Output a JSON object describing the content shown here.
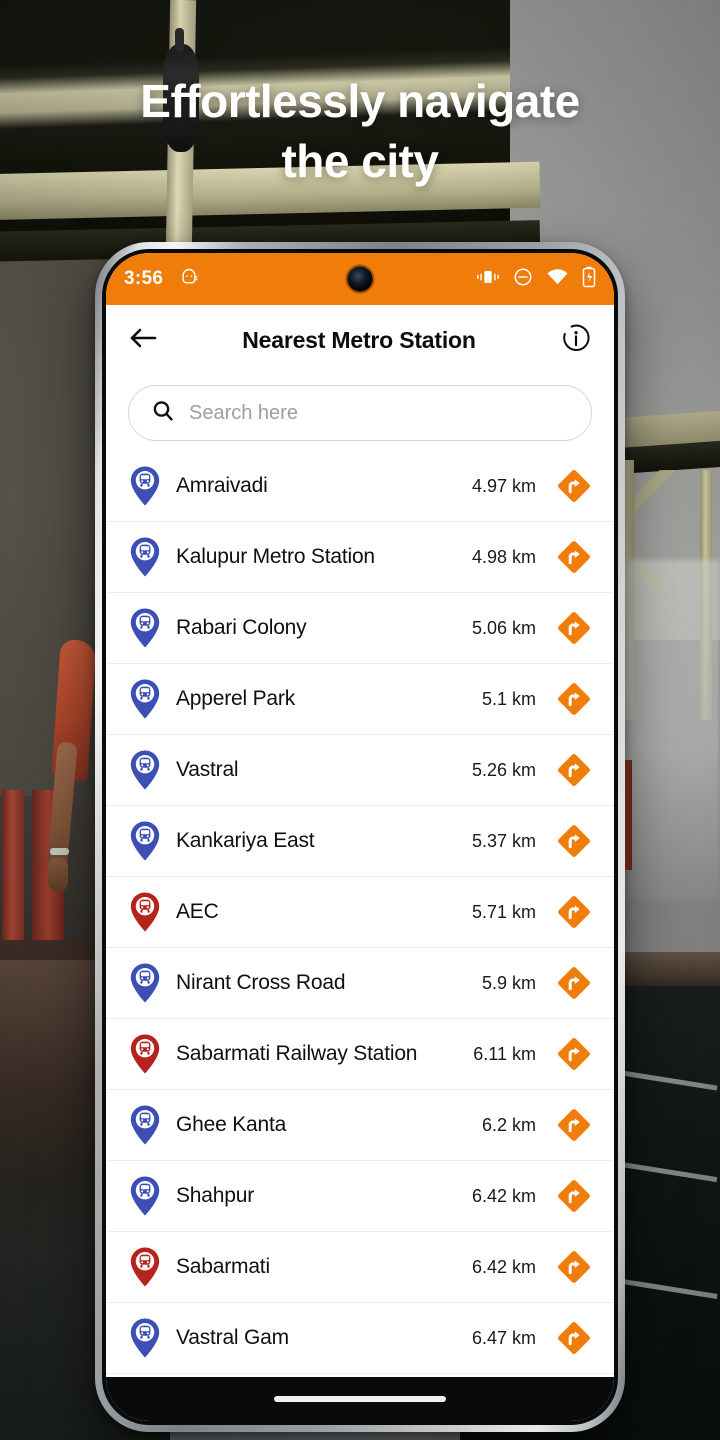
{
  "headline": "Effortlessly navigate\nthe city",
  "theme": {
    "accent_orange": "#F07C0A",
    "metro_pin_blue": "#3B4FB5",
    "railway_pin_red": "#B5241C",
    "screen_bg": "#FFFFFF"
  },
  "phone": {
    "statusbar": {
      "time": "3:56",
      "left_icons": [
        "android-debug-icon"
      ],
      "right_icons": [
        "vibrate-icon",
        "do-not-disturb-icon",
        "wifi-icon",
        "battery-charging-icon"
      ],
      "camera": "punch-hole-camera"
    },
    "appbar": {
      "back_icon": "back-arrow-icon",
      "title": "Nearest Metro Station",
      "info_icon": "info-icon"
    },
    "search": {
      "icon": "search-icon",
      "placeholder": "Search here",
      "value": ""
    },
    "list": {
      "go_icon": "directions-arrow-icon",
      "items": [
        {
          "name": "Amraivadi",
          "distance": "4.97 km",
          "pin": "metro",
          "pin_color": "#3B4FB5"
        },
        {
          "name": "Kalupur Metro Station",
          "distance": "4.98 km",
          "pin": "metro",
          "pin_color": "#3B4FB5"
        },
        {
          "name": "Rabari Colony",
          "distance": "5.06 km",
          "pin": "metro",
          "pin_color": "#3B4FB5"
        },
        {
          "name": "Apperel Park",
          "distance": "5.1 km",
          "pin": "metro",
          "pin_color": "#3B4FB5"
        },
        {
          "name": "Vastral",
          "distance": "5.26 km",
          "pin": "metro",
          "pin_color": "#3B4FB5"
        },
        {
          "name": "Kankariya East",
          "distance": "5.37 km",
          "pin": "metro",
          "pin_color": "#3B4FB5"
        },
        {
          "name": "AEC",
          "distance": "5.71 km",
          "pin": "railway",
          "pin_color": "#B5241C"
        },
        {
          "name": "Nirant Cross Road",
          "distance": "5.9 km",
          "pin": "metro",
          "pin_color": "#3B4FB5"
        },
        {
          "name": "Sabarmati Railway Station",
          "distance": "6.11 km",
          "pin": "railway",
          "pin_color": "#B5241C"
        },
        {
          "name": "Ghee Kanta",
          "distance": "6.2 km",
          "pin": "metro",
          "pin_color": "#3B4FB5"
        },
        {
          "name": "Shahpur",
          "distance": "6.42 km",
          "pin": "metro",
          "pin_color": "#3B4FB5"
        },
        {
          "name": "Sabarmati",
          "distance": "6.42 km",
          "pin": "railway",
          "pin_color": "#B5241C"
        },
        {
          "name": "Vastral Gam",
          "distance": "6.47 km",
          "pin": "metro",
          "pin_color": "#3B4FB5"
        }
      ]
    },
    "navbar": {
      "gesture_bar": "home-gesture-pill"
    }
  }
}
